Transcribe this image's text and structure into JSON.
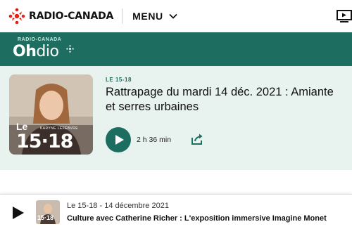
{
  "header": {
    "brand": "RADIO-CANADA",
    "menu_label": "MENU",
    "icons": {
      "brand": "radio-canada-gem-icon",
      "menu": "chevron-down-icon",
      "tv": "tv-play-icon"
    }
  },
  "band": {
    "kicker": "RADIO-CANADA",
    "logo_bold": "Oh",
    "logo_light": "dio",
    "accent": "#1d6e61"
  },
  "episode": {
    "show": "LE 15-18",
    "title_line1": "Rattrapage du mardi 14 déc. 2021 : Amiante",
    "title_line2": "et serres urbaines",
    "duration": "2 h 36 min",
    "thumb": {
      "host": "KARYNE LEFEBVRE",
      "show_small": "Le",
      "show_big": "15·18"
    },
    "icons": {
      "play": "play-icon",
      "share": "share-icon"
    }
  },
  "player": {
    "line1": "Le 15-18 - 14 décembre 2021",
    "line2": "Culture avec Catherine Richer : L'exposition immersive Imagine Monet",
    "thumb_label": "15·18",
    "icons": {
      "play": "play-icon"
    }
  },
  "colors": {
    "card_bg": "#e8f2ef",
    "band_bg": "#1d6e61",
    "gem_red": "#e2231a"
  }
}
